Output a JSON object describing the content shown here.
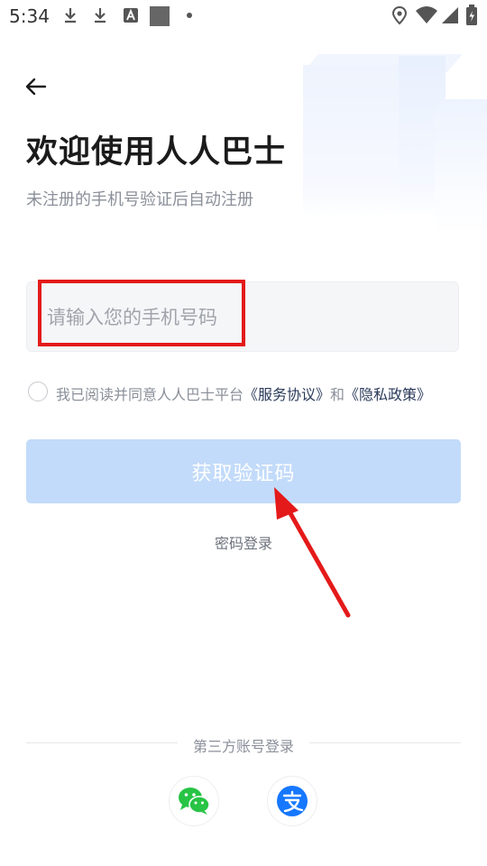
{
  "status_bar": {
    "time": "5:34",
    "icons": [
      "download-icon",
      "download-icon",
      "font-a-icon",
      "image-icon",
      "dot-icon",
      "location-icon",
      "wifi-icon",
      "signal-icon",
      "battery-icon"
    ]
  },
  "header": {
    "back_icon": "arrow-left-icon",
    "title": "欢迎使用人人巴士",
    "subtitle": "未注册的手机号验证后自动注册"
  },
  "login_form": {
    "phone_placeholder": "请输入您的手机号码",
    "phone_value": "",
    "agreement": {
      "prefix": "我已阅读并同意人人巴士平台",
      "service_link": "《服务协议》",
      "conjunction": "和",
      "privacy_link": "《隐私政策》",
      "checked": false
    },
    "get_code_button": "获取验证码",
    "password_login_link": "密码登录"
  },
  "third_party": {
    "label": "第三方账号登录",
    "providers": [
      {
        "name": "wechat",
        "icon": "wechat-icon",
        "color": "#28c445"
      },
      {
        "name": "alipay",
        "icon": "alipay-icon",
        "color": "#1677ff"
      }
    ]
  },
  "annotation": {
    "highlight_color": "#e41a1a"
  },
  "colors": {
    "primary_disabled": "#c3dbfa",
    "title": "#1b1b1b",
    "muted": "#8a8f99"
  }
}
